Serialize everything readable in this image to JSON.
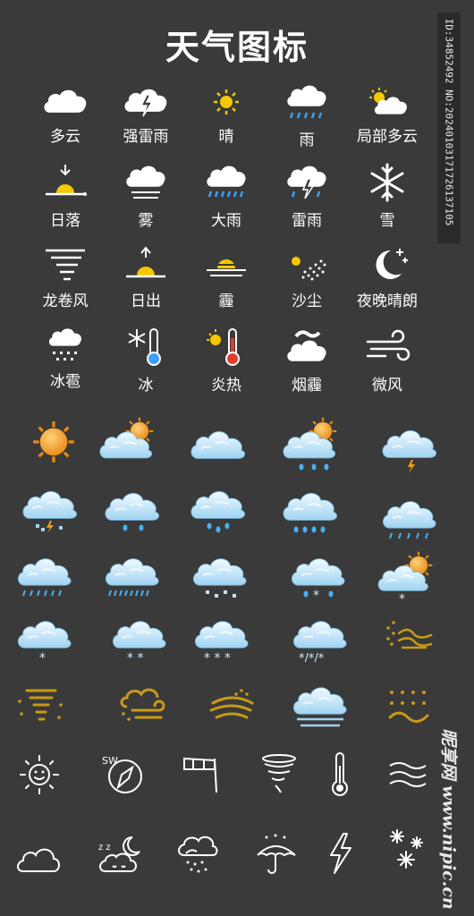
{
  "title": "天气图标",
  "side_id": "ID:34852492 NO:20240103171726137105",
  "watermark": "昵享网 www.nipic.cn",
  "labels": [
    [
      "多云",
      "强雷雨",
      "晴",
      "雨",
      "局部多云"
    ],
    [
      "日落",
      "雾",
      "大雨",
      "雷雨",
      "雪"
    ],
    [
      "龙卷风",
      "日出",
      "霾",
      "沙尘",
      "夜晚晴朗"
    ],
    [
      "冰雹",
      "冰",
      "炎热",
      "烟霾",
      "微风"
    ]
  ],
  "colors": {
    "background": "#3a3a3a",
    "icon_white": "#ffffff",
    "sun_yellow": "#f6c800",
    "rain_blue": "#3ba0ff",
    "orange_sun": "#f39a1e",
    "cloud_blue": "#bfe4fa",
    "wind_gold": "#c99a17"
  }
}
